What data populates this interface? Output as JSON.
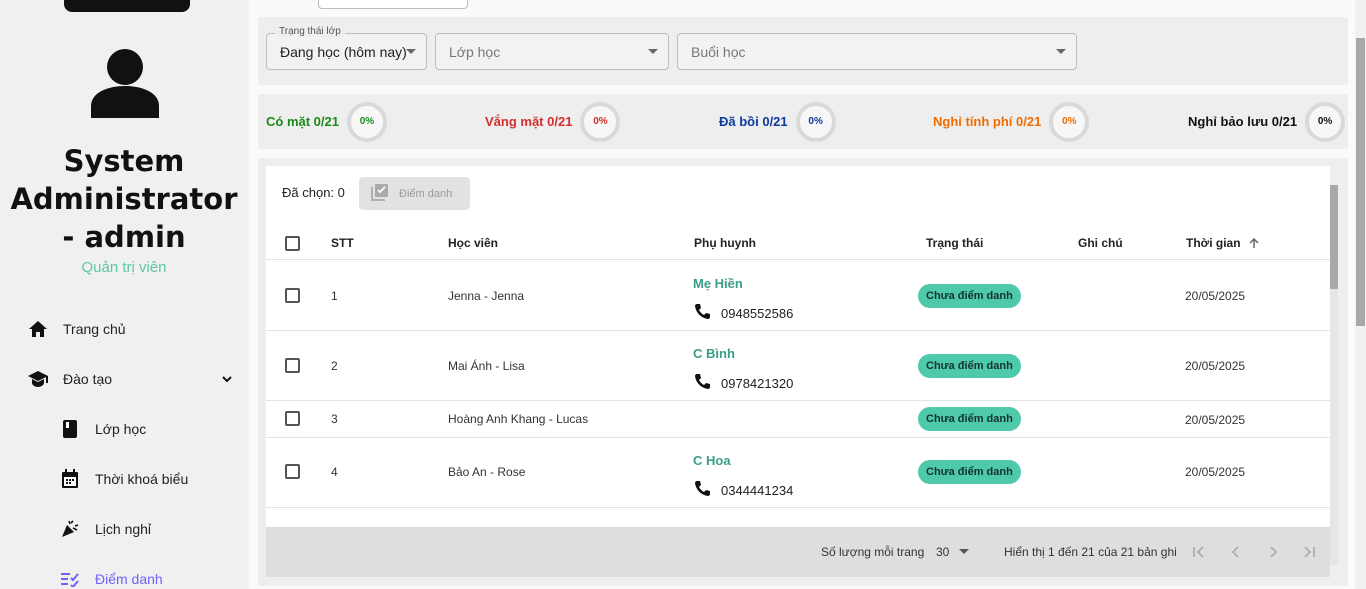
{
  "sidebar": {
    "user_name": "System Administrator - admin",
    "user_role": "Quản trị viên",
    "items": [
      {
        "label": "Trang chủ",
        "icon": "home-icon"
      },
      {
        "label": "Đào tạo",
        "icon": "graduation-cap-icon"
      },
      {
        "label": "Lớp học",
        "icon": "book-icon"
      },
      {
        "label": "Thời khoá biểu",
        "icon": "calendar-icon"
      },
      {
        "label": "Lịch nghỉ",
        "icon": "party-popper-icon"
      },
      {
        "label": "Điểm danh",
        "icon": "checklist-icon"
      }
    ]
  },
  "filters": {
    "status_legend": "Trạng thái lớp",
    "status_value": "Đang học (hôm nay)",
    "class_placeholder": "Lớp học",
    "session_placeholder": "Buổi học"
  },
  "stats": [
    {
      "label": "Có mặt 0/21",
      "percent": "0%",
      "color": "#1b8a1b"
    },
    {
      "label": "Vắng mặt 0/21",
      "percent": "0%",
      "color": "#d32f2f"
    },
    {
      "label": "Đã bồi 0/21",
      "percent": "0%",
      "color": "#0d3a9e"
    },
    {
      "label": "Nghỉ tính phí 0/21",
      "percent": "0%",
      "color": "#ef6c00"
    },
    {
      "label": "Nghỉ bảo lưu 0/21",
      "percent": "0%",
      "color": "#111111"
    }
  ],
  "toolbar": {
    "selected_label": "Đã chọn: 0",
    "attend_button": "Điểm danh"
  },
  "table": {
    "headers": [
      "STT",
      "Học viên",
      "Phụ huynh",
      "Trạng thái",
      "Ghi chú",
      "Thời gian"
    ],
    "rows": [
      {
        "stt": "1",
        "student": "Jenna - Jenna",
        "parent": "Mẹ Hiền",
        "phone": "0948552586",
        "status": "Chưa điểm danh",
        "note": "",
        "time": "20/05/2025"
      },
      {
        "stt": "2",
        "student": "Mai Ánh - Lisa",
        "parent": "C Bình",
        "phone": "0978421320",
        "status": "Chưa điểm danh",
        "note": "",
        "time": "20/05/2025"
      },
      {
        "stt": "3",
        "student": "Hoàng Anh Khang - Lucas",
        "parent": "",
        "phone": "",
        "status": "Chưa điểm danh",
        "note": "",
        "time": "20/05/2025"
      },
      {
        "stt": "4",
        "student": "Bảo An - Rose",
        "parent": "C Hoa",
        "phone": "0344441234",
        "status": "Chưa điểm danh",
        "note": "",
        "time": "20/05/2025"
      }
    ]
  },
  "pagination": {
    "rows_per_page_label": "Số lượng mỗi trang",
    "rows_per_page_value": "30",
    "range_text": "Hiển thị 1 đến 21 của 21 bản ghi"
  }
}
